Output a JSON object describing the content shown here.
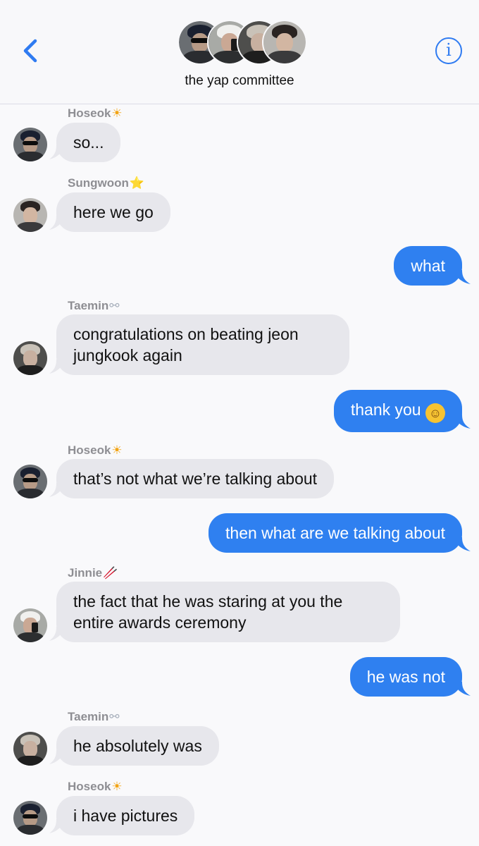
{
  "header": {
    "group_name": "the yap committee",
    "back_icon": "chevron-left-icon",
    "info_icon": "info-icon",
    "info_glyph": "i",
    "accent_color": "#2f7bf1"
  },
  "members": {
    "hoseok": {
      "name": "Hoseok",
      "emoji": "☀"
    },
    "sungwoon": {
      "name": "Sungwoon",
      "emoji": "⭐"
    },
    "taemin": {
      "name": "Taemin",
      "emoji": "⚯"
    },
    "jinnie": {
      "name": "Jinnie",
      "emoji": "🥢"
    }
  },
  "messages": [
    {
      "direction": "incoming",
      "sender": "Hoseok",
      "sender_emoji": "☀",
      "text": "so..."
    },
    {
      "direction": "incoming",
      "sender": "Sungwoon",
      "sender_emoji": "⭐",
      "text": "here we go"
    },
    {
      "direction": "outgoing",
      "text": "what"
    },
    {
      "direction": "incoming",
      "sender": "Taemin",
      "sender_emoji": "⚯",
      "text_line1": "congratulations on beating jeon",
      "text_line2": "jungkook again"
    },
    {
      "direction": "outgoing",
      "text": "thank you",
      "emoji": "☺"
    },
    {
      "direction": "incoming",
      "sender": "Hoseok",
      "sender_emoji": "☀",
      "text": "that’s not what we’re talking about"
    },
    {
      "direction": "outgoing",
      "text": "then what are we talking about"
    },
    {
      "direction": "incoming",
      "sender": "Jinnie",
      "sender_emoji": "🥢",
      "text_line1": "the fact that he was staring at you the",
      "text_line2": "entire awards ceremony"
    },
    {
      "direction": "outgoing",
      "text": "he was not"
    },
    {
      "direction": "incoming",
      "sender": "Taemin",
      "sender_emoji": "⚯",
      "text": "he absolutely was"
    },
    {
      "direction": "incoming",
      "sender": "Hoseok",
      "sender_emoji": "☀",
      "text": "i have pictures"
    }
  ],
  "colors": {
    "outgoing_bubble": "#2f80f0",
    "incoming_bubble": "#e7e7ec",
    "sender_name": "#8e8e93",
    "background": "#f9f9fb"
  }
}
